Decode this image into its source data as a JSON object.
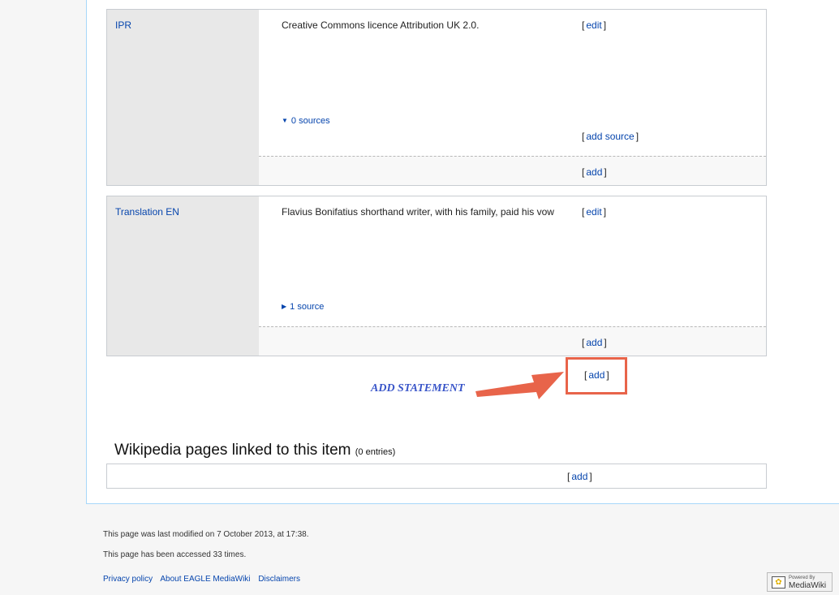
{
  "statements": [
    {
      "property": "IPR",
      "value": "Creative Commons licence Attribution UK 2.0.",
      "edit_label": "edit",
      "sources_label": "0 sources",
      "add_source_label": "add source",
      "add_label": "add"
    },
    {
      "property": "Translation EN",
      "value": "Flavius Bonifatius shorthand writer, with his family, paid his vow",
      "edit_label": "edit",
      "sources_label": "1 source",
      "add_label": "add"
    }
  ],
  "add_statement": {
    "link_label": "add",
    "annotation": "ADD STATEMENT",
    "annotation_color": "#e8644a"
  },
  "sitelinks": {
    "heading": "Wikipedia pages linked to this item",
    "count": "(0 entries)",
    "add_label": "add"
  },
  "footer": {
    "last_modified": "This page was last modified on 7 October 2013, at 17:38.",
    "accessed": "This page has been accessed 33 times.",
    "links": [
      "Privacy policy",
      "About EAGLE MediaWiki",
      "Disclaimers"
    ],
    "powered_small": "Powered By",
    "powered_big": "MediaWiki"
  }
}
